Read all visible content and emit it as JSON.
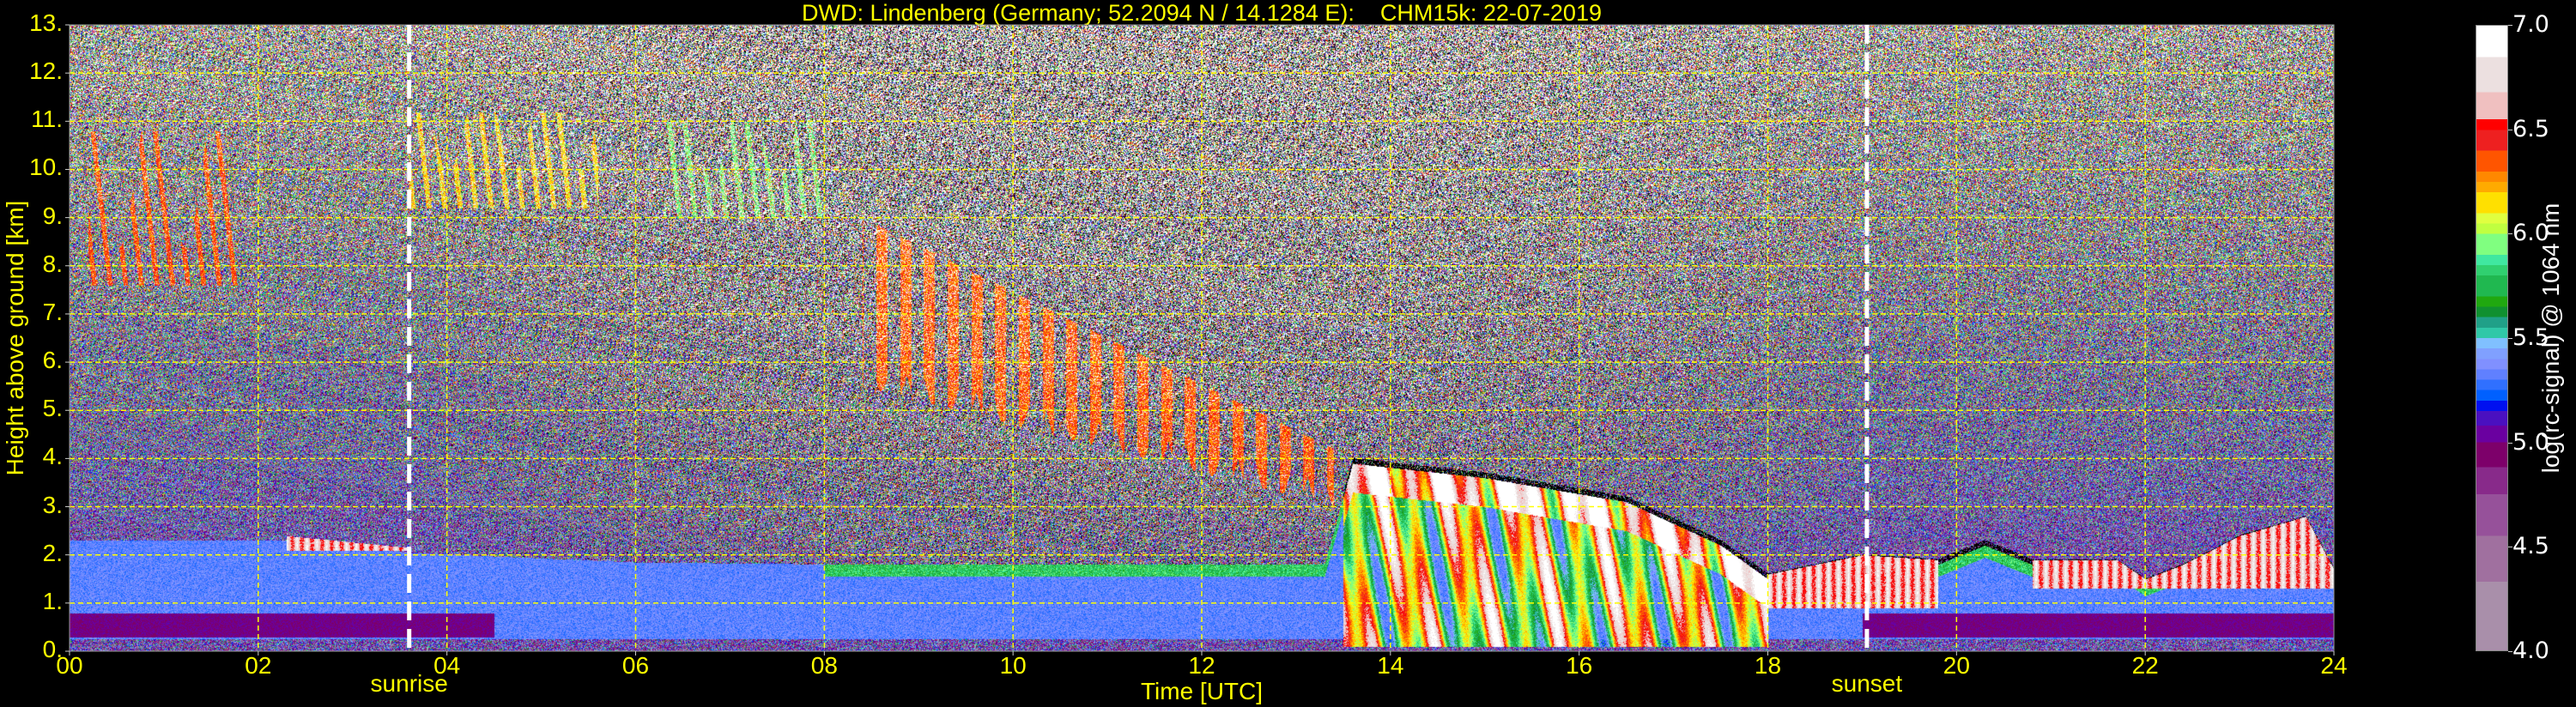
{
  "chart_data": {
    "type": "heatmap",
    "title": "DWD: Lindenberg (Germany; 52.2094 N / 14.1284 E):    CHM15k: 22-07-2019",
    "xlabel": "Time [UTC]",
    "ylabel": "Height above ground [km]",
    "xlim": [
      0,
      24
    ],
    "ylim": [
      0,
      13
    ],
    "x_ticks": [
      0,
      2,
      4,
      6,
      8,
      10,
      12,
      14,
      16,
      18,
      20,
      22,
      24
    ],
    "x_tick_labels": [
      "00",
      "02",
      "04",
      "06",
      "08",
      "10",
      "12",
      "14",
      "16",
      "18",
      "20",
      "22",
      "24"
    ],
    "y_ticks": [
      0,
      1,
      2,
      3,
      4,
      5,
      6,
      7,
      8,
      9,
      10,
      11,
      12,
      13
    ],
    "y_tick_labels": [
      "0.",
      "1.",
      "2.",
      "3.",
      "4.",
      "5.",
      "6.",
      "7.",
      "8.",
      "9.",
      "10.",
      "11.",
      "12.",
      "13."
    ],
    "grid": true,
    "grid_color": "#ffff00",
    "annotations": [
      {
        "label": "sunrise",
        "time": 3.6
      },
      {
        "label": "sunset",
        "time": 19.05
      }
    ],
    "colorbar": {
      "label": "log(rc-signal) @ 1064 nm",
      "range": [
        4.0,
        7.0
      ],
      "ticks": [
        4.0,
        4.5,
        5.0,
        5.5,
        6.0,
        6.5,
        7.0
      ],
      "tick_labels": [
        "4.0",
        "4.5",
        "5.0",
        "5.5",
        "6.0",
        "6.5",
        "7.0"
      ],
      "stops": [
        [
          4.0,
          "#a98faa"
        ],
        [
          4.33,
          "#a0709f"
        ],
        [
          4.55,
          "#96519a"
        ],
        [
          4.75,
          "#882a8a"
        ],
        [
          4.88,
          "#7d006a"
        ],
        [
          5.0,
          "#6a00a0"
        ],
        [
          5.08,
          "#4a10c0"
        ],
        [
          5.15,
          "#0010f0"
        ],
        [
          5.2,
          "#0060ff"
        ],
        [
          5.25,
          "#3070ff"
        ],
        [
          5.3,
          "#6080ff"
        ],
        [
          5.35,
          "#8090ff"
        ],
        [
          5.4,
          "#80a0ff"
        ],
        [
          5.45,
          "#80c0ff"
        ],
        [
          5.5,
          "#30c8a8"
        ],
        [
          5.55,
          "#20a088"
        ],
        [
          5.6,
          "#109030"
        ],
        [
          5.65,
          "#20a810"
        ],
        [
          5.7,
          "#20b850"
        ],
        [
          5.8,
          "#30d070"
        ],
        [
          5.85,
          "#40e8a0"
        ],
        [
          5.9,
          "#80ff80"
        ],
        [
          6.0,
          "#c0ff40"
        ],
        [
          6.05,
          "#e0ff40"
        ],
        [
          6.1,
          "#ffe000"
        ],
        [
          6.2,
          "#ffaa00"
        ],
        [
          6.25,
          "#ff8800"
        ],
        [
          6.3,
          "#ff5500"
        ],
        [
          6.4,
          "#ee2020"
        ],
        [
          6.5,
          "#ff0000"
        ],
        [
          6.55,
          "#f0c0c0"
        ],
        [
          6.68,
          "#ece0e0"
        ],
        [
          6.85,
          "#ffffff"
        ]
      ]
    },
    "boundary_layer_top_km": [
      [
        0,
        2.3
      ],
      [
        2.3,
        2.3
      ],
      [
        3.6,
        2.05
      ],
      [
        6,
        1.85
      ],
      [
        8.5,
        1.8
      ],
      [
        13.3,
        1.8
      ],
      [
        13.6,
        3.9
      ],
      [
        15,
        3.6
      ],
      [
        16.5,
        3.1
      ],
      [
        17.5,
        2.2
      ],
      [
        18,
        1.5
      ],
      [
        19,
        1.9
      ],
      [
        19.8,
        1.8
      ],
      [
        20.3,
        2.2
      ],
      [
        20.8,
        1.8
      ],
      [
        21.7,
        1.8
      ],
      [
        22,
        1.4
      ],
      [
        22.4,
        1.7
      ],
      [
        23,
        2.3
      ],
      [
        23.7,
        2.7
      ],
      [
        24,
        1.6
      ]
    ],
    "cloud_features": [
      {
        "kind": "cirrus",
        "time": [
          0.2,
          1.8
        ],
        "height": [
          7.6,
          10.8
        ],
        "value": 6.4
      },
      {
        "kind": "cirrus",
        "time": [
          3.6,
          5.6
        ],
        "height": [
          9.2,
          11.2
        ],
        "value": 6.2
      },
      {
        "kind": "cirrus",
        "time": [
          6.3,
          8.0
        ],
        "height": [
          9.0,
          11.0
        ],
        "value": 6.0
      },
      {
        "kind": "virga",
        "time": [
          8.4,
          13.4
        ],
        "height_top": [
          9.0,
          4.2
        ],
        "height_bottom": [
          6.0,
          3.5
        ],
        "value": 6.4
      },
      {
        "kind": "bl-top-cloud",
        "time": [
          2.3,
          3.6
        ],
        "height": [
          2.1,
          2.5
        ],
        "value": 6.9
      },
      {
        "kind": "convective",
        "time": [
          13.5,
          18.0
        ],
        "value": 6.8
      },
      {
        "kind": "evening-stratus",
        "time": [
          18.0,
          19.8
        ],
        "height": [
          0.9,
          2.1
        ],
        "value": 6.9
      },
      {
        "kind": "night-bl-cloud",
        "time": [
          20.8,
          24.0
        ],
        "height": [
          1.3,
          2.9
        ],
        "value": 6.9
      }
    ]
  }
}
